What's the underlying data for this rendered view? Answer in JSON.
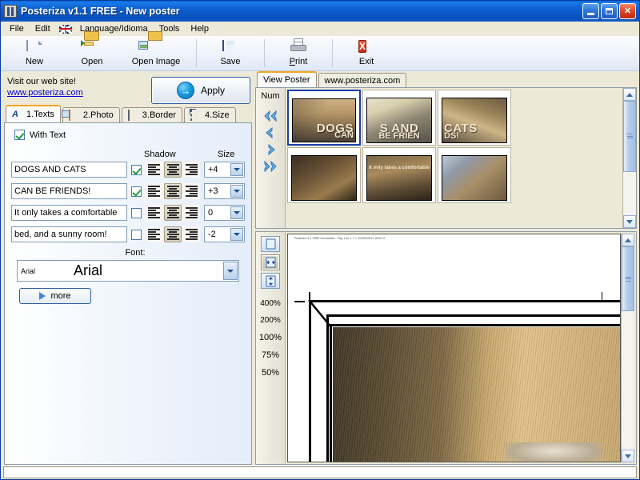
{
  "window": {
    "title": "Posteriza v1.1 FREE - New poster",
    "app_icon": "posteriza-icon",
    "buttons": {
      "minimize": "minimize",
      "maximize": "maximize",
      "close": "close"
    }
  },
  "menubar": {
    "items": [
      {
        "label": "File"
      },
      {
        "label": "Edit"
      },
      {
        "label": "Language/Idioma",
        "icon": "uk-flag-icon"
      },
      {
        "label": "Tools"
      },
      {
        "label": "Help"
      }
    ]
  },
  "toolbar": {
    "new_label": "New",
    "open_label": "Open",
    "open_image_label": "Open Image",
    "save_label": "Save",
    "print_label_pre": "P",
    "print_label_post": "rint",
    "exit_label": "Exit",
    "exit_glyph": "X"
  },
  "promo": {
    "line1": "Visit our web site!",
    "link": "www.posteriza.com"
  },
  "apply": {
    "label": "Apply",
    "glyph": "→"
  },
  "tabs": [
    {
      "label": "1.Texts",
      "icon": "texts-icon",
      "glyph": "A",
      "active": true
    },
    {
      "label": "2.Photo",
      "icon": "photo-icon",
      "active": false
    },
    {
      "label": "3.Border",
      "icon": "border-icon",
      "active": false
    },
    {
      "label": "4.Size",
      "icon": "size-icon",
      "active": false
    }
  ],
  "texts_panel": {
    "with_text_label": "With Text",
    "with_text_checked": true,
    "shadow_header": "Shadow",
    "size_header": "Size",
    "rows": [
      {
        "value": "DOGS AND CATS",
        "shadow": true,
        "align": "center",
        "size": "+4"
      },
      {
        "value": "CAN BE FRIENDS!",
        "shadow": true,
        "align": "center",
        "size": "+3"
      },
      {
        "value": "It only takes a comfortable",
        "shadow": false,
        "align": "center",
        "size": "0"
      },
      {
        "value": "bed, and a sunny room!",
        "shadow": false,
        "align": "center",
        "size": "-2"
      }
    ],
    "font_label": "Font:",
    "font_name_small": "Arial",
    "font_name_preview": "Arial",
    "more_label": "more"
  },
  "right_tabs": [
    {
      "label": "View Poster",
      "active": true
    },
    {
      "label": "www.posteriza.com",
      "active": false
    }
  ],
  "thumbnails": {
    "num_label": "Num",
    "nav": [
      {
        "name": "first-page-arrow",
        "dir": "double-left"
      },
      {
        "name": "prev-page-arrow",
        "dir": "left"
      },
      {
        "name": "next-page-arrow",
        "dir": "right"
      },
      {
        "name": "last-page-arrow",
        "dir": "double-right"
      }
    ],
    "tiles": [
      {
        "selected": true,
        "photo": "ph-a",
        "text": "DOGS",
        "text2": "CAN",
        "text3": ""
      },
      {
        "selected": false,
        "photo": "ph-b",
        "text": "S AND",
        "text2": "BE FRIEN",
        "text3": ""
      },
      {
        "selected": false,
        "photo": "ph-c",
        "text": "CATS",
        "text2": "DS!",
        "text3": ""
      },
      {
        "selected": false,
        "photo": "ph-d",
        "text": "",
        "text2": "",
        "text3": ""
      },
      {
        "selected": false,
        "photo": "ph-e",
        "text": "",
        "text2": "",
        "text3": "It only takes a comfortable"
      },
      {
        "selected": false,
        "photo": "ph-f",
        "text": "",
        "text2": "",
        "text3": ""
      }
    ]
  },
  "preview": {
    "page_header": "Posteriza v1.1 FREE  Innovasoftw - Pag. 1 de 1. V = 1/2006-05-07  18:51:27",
    "view_modes": [
      {
        "name": "fit-page",
        "active": false
      },
      {
        "name": "fit-width",
        "active": true
      },
      {
        "name": "fit-height",
        "active": false
      }
    ],
    "zoom_levels": [
      "400%",
      "200%",
      "100%",
      "75%",
      "50%"
    ]
  },
  "colors": {
    "title_blue": "#0a4fbc",
    "tab_orange": "#f5a623",
    "selection_blue": "#1b3fa8",
    "link_blue": "#0000cc",
    "panel_face": "#ece9d8"
  }
}
